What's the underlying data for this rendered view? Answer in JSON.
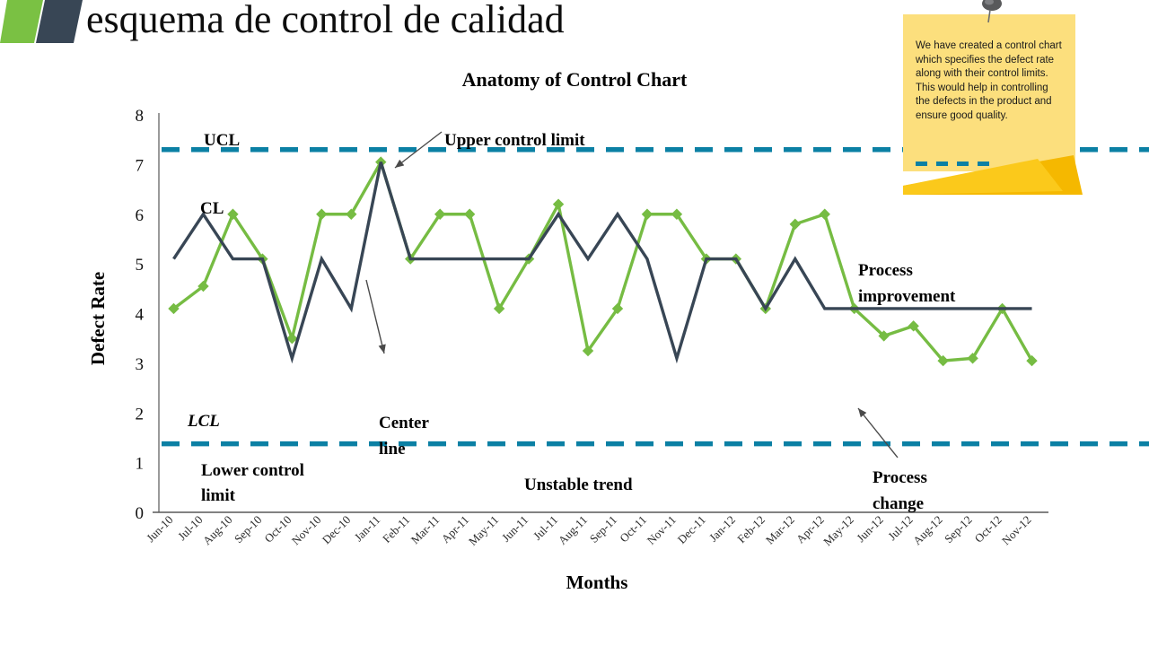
{
  "header": {
    "title": "esquema de control de calidad",
    "logo_green": "#7ac143",
    "logo_navy": "#384655"
  },
  "sticky": {
    "text": "We have  created  a control chart which  specifies the defect rate along with their control limits. This  would help in controlling the defects  in the product  and ensure good  quality.",
    "note_color": "#fcdf7d",
    "fold_color": "#f5b800",
    "pin_color": "#58595b",
    "dash_color": "#0b80a4"
  },
  "chart_data": {
    "type": "line",
    "title": "Anatomy of Control Chart",
    "xlabel": "Months",
    "ylabel": "Defect Rate",
    "ylim": [
      0,
      8
    ],
    "yticks": [
      "0",
      "1",
      "2",
      "3",
      "4",
      "5",
      "6",
      "7",
      "8"
    ],
    "grid": false,
    "legend": "none",
    "categories": [
      "Jun-10",
      "Jul-10",
      "Aug-10",
      "Sep-10",
      "Oct-10",
      "Nov-10",
      "Dec-10",
      "Jan-11",
      "Feb-11",
      "Mar-11",
      "Apr-11",
      "May-11",
      "Jun-11",
      "Jul-11",
      "Aug-11",
      "Sep-11",
      "Oct-11",
      "Nov-11",
      "Dec-11",
      "Jan-12",
      "Feb-12",
      "Mar-12",
      "Apr-12",
      "May-12",
      "Jun-12",
      "Jul-12",
      "Aug-12",
      "Sep-12",
      "Oct-12",
      "Nov-12"
    ],
    "series": [
      {
        "name": "Defect Rate",
        "color": "#76bc43",
        "marker": "diamond",
        "values": [
          4.1,
          4.55,
          6.0,
          5.1,
          3.5,
          6.0,
          6.0,
          7.05,
          5.1,
          6.0,
          6.0,
          4.1,
          5.1,
          6.2,
          3.25,
          4.1,
          6.0,
          6.0,
          5.1,
          5.1,
          4.1,
          5.8,
          6.0,
          4.1,
          3.55,
          3.75,
          3.05,
          3.1,
          4.1,
          3.05
        ]
      },
      {
        "name": "Center line",
        "color": "#384655",
        "marker": "none",
        "values": [
          5.1,
          6.0,
          5.1,
          5.1,
          3.1,
          5.1,
          4.1,
          7.05,
          5.1,
          5.1,
          5.1,
          5.1,
          5.1,
          6.0,
          5.1,
          6.0,
          5.1,
          3.1,
          5.1,
          5.1,
          4.1,
          5.1,
          4.1,
          4.1,
          4.1,
          4.1,
          4.1,
          4.1,
          4.1,
          4.1
        ]
      }
    ],
    "control_limits": [
      {
        "name": "UCL",
        "value": 7.3,
        "color": "#0b80a4",
        "style": "dashed"
      },
      {
        "name": "LCL",
        "value": 1.38,
        "color": "#0b80a4",
        "style": "dashed"
      }
    ],
    "annotations": [
      {
        "id": "ucl-short",
        "text": "UCL"
      },
      {
        "id": "lcl-short",
        "text": "LCL"
      },
      {
        "id": "cl-short",
        "text": "CL"
      },
      {
        "id": "ucl-long",
        "text": "Upper control limit"
      },
      {
        "id": "lcl-long1",
        "text": "Lower control"
      },
      {
        "id": "lcl-long2",
        "text": "limit"
      },
      {
        "id": "center1",
        "text": "Center"
      },
      {
        "id": "center2",
        "text": "line"
      },
      {
        "id": "unstable",
        "text": "Unstable trend"
      },
      {
        "id": "improve1",
        "text": "Process"
      },
      {
        "id": "improve2",
        "text": "improvement"
      },
      {
        "id": "change1",
        "text": "Process"
      },
      {
        "id": "change2",
        "text": "change"
      }
    ]
  }
}
